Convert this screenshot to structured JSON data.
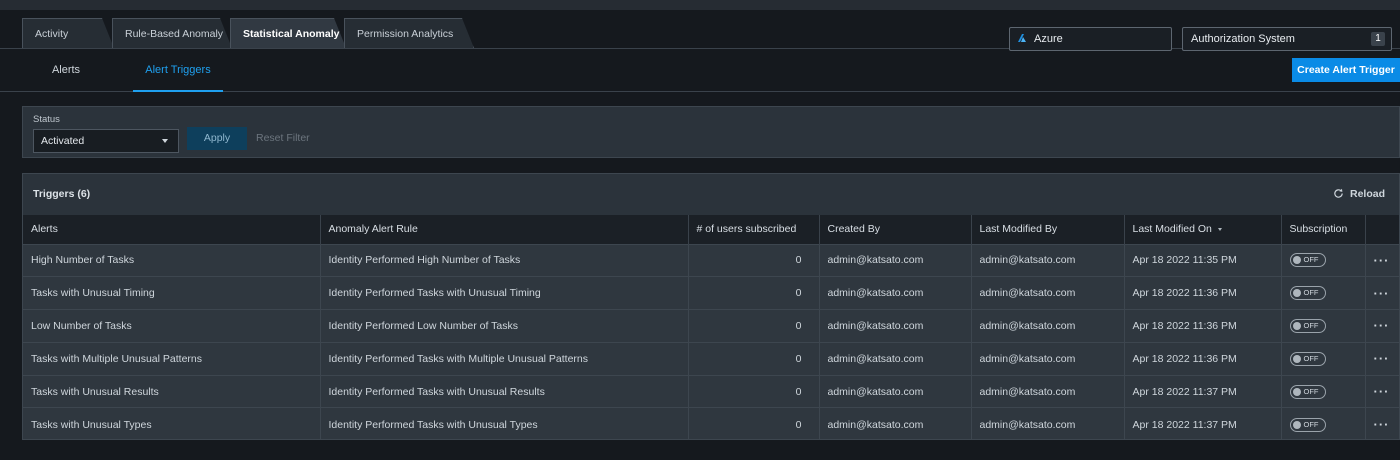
{
  "tabs": [
    {
      "label": "Activity",
      "active": false
    },
    {
      "label": "Rule-Based Anomaly",
      "active": false
    },
    {
      "label": "Statistical Anomaly",
      "active": true
    },
    {
      "label": "Permission Analytics",
      "active": false
    }
  ],
  "cloud_selector": {
    "value": "Azure"
  },
  "auth_system_selector": {
    "label": "Authorization System",
    "count": "1"
  },
  "subnav": {
    "alerts": "Alerts",
    "alert_triggers": "Alert Triggers",
    "create_button": "Create Alert Trigger"
  },
  "filter": {
    "status_label": "Status",
    "status_value": "Activated",
    "apply": "Apply",
    "reset": "Reset Filter"
  },
  "panel": {
    "title": "Triggers (6)",
    "reload": "Reload"
  },
  "table": {
    "headers": [
      "Alerts",
      "Anomaly Alert Rule",
      "# of users subscribed",
      "Created By",
      "Last Modified By",
      "Last Modified On",
      "Subscription",
      ""
    ],
    "rows": [
      {
        "alert": "High Number of Tasks",
        "rule": "Identity Performed High Number of Tasks",
        "subscribed": "0",
        "created_by": "admin@katsato.com",
        "modified_by": "admin@katsato.com",
        "modified_on": "Apr 18 2022 11:35 PM",
        "subscription": "OFF",
        "more": "···"
      },
      {
        "alert": "Tasks with Unusual Timing",
        "rule": "Identity Performed Tasks with Unusual Timing",
        "subscribed": "0",
        "created_by": "admin@katsato.com",
        "modified_by": "admin@katsato.com",
        "modified_on": "Apr 18 2022 11:36 PM",
        "subscription": "OFF",
        "more": "···"
      },
      {
        "alert": "Low Number of Tasks",
        "rule": "Identity Performed Low Number of Tasks",
        "subscribed": "0",
        "created_by": "admin@katsato.com",
        "modified_by": "admin@katsato.com",
        "modified_on": "Apr 18 2022 11:36 PM",
        "subscription": "OFF",
        "more": "···"
      },
      {
        "alert": "Tasks with Multiple Unusual Patterns",
        "rule": "Identity Performed Tasks with Multiple Unusual Patterns",
        "subscribed": "0",
        "created_by": "admin@katsato.com",
        "modified_by": "admin@katsato.com",
        "modified_on": "Apr 18 2022 11:36 PM",
        "subscription": "OFF",
        "more": "···"
      },
      {
        "alert": "Tasks with Unusual Results",
        "rule": "Identity Performed Tasks with Unusual Results",
        "subscribed": "0",
        "created_by": "admin@katsato.com",
        "modified_by": "admin@katsato.com",
        "modified_on": "Apr 18 2022 11:37 PM",
        "subscription": "OFF",
        "more": "···"
      },
      {
        "alert": "Tasks with Unusual Types",
        "rule": "Identity Performed Tasks with Unusual Types",
        "subscribed": "0",
        "created_by": "admin@katsato.com",
        "modified_by": "admin@katsato.com",
        "modified_on": "Apr 18 2022 11:37 PM",
        "subscription": "OFF",
        "more": "···"
      }
    ]
  },
  "colors": {
    "accent": "#1fa0ef",
    "primary_button": "#0a8be6",
    "azure": "#1f8fe0"
  },
  "icons": {
    "cloud": "azure-icon",
    "reload": "reload-icon",
    "sort": "sort-desc-icon",
    "row_menu": "more-icon"
  }
}
